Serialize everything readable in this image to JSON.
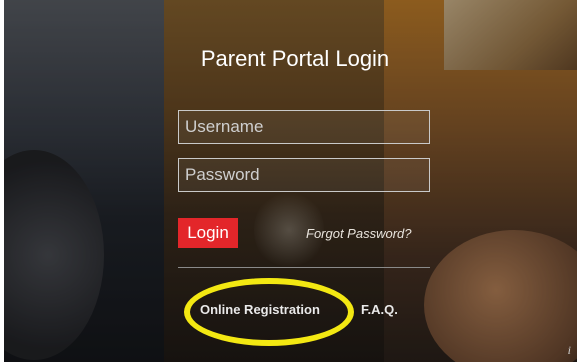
{
  "login": {
    "title": "Parent Portal Login",
    "username_placeholder": "Username",
    "password_placeholder": "Password",
    "login_label": "Login",
    "forgot_label": "Forgot Password?"
  },
  "links": {
    "online_registration": "Online Registration",
    "faq": "F.A.Q."
  },
  "info_icon": "i",
  "colors": {
    "login_button": "#e3262a",
    "highlight": "#f3e812"
  }
}
